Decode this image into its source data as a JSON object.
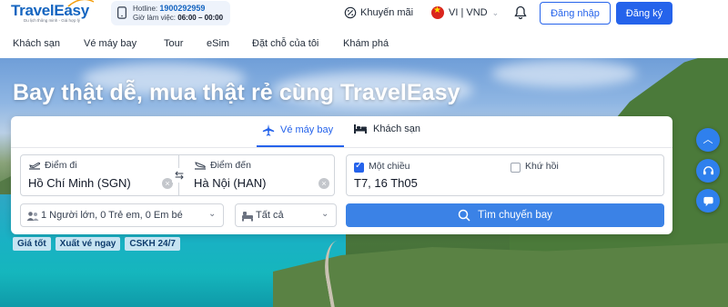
{
  "header": {
    "logo": "TravelEasy",
    "logo_tagline": "Du lịch thông minh - Giá hợp lý",
    "hotline_label": "Hotline:",
    "hotline_number": "1900292959",
    "hours_label": "Giờ làm việc:",
    "hours_value": "06:00 – 00:00",
    "promo": "Khuyến mãi",
    "lang_currency": "VI | VND",
    "login": "Đăng nhập",
    "register": "Đăng ký"
  },
  "nav": [
    "Khách sạn",
    "Vé máy bay",
    "Tour",
    "eSim",
    "Đặt chỗ của tôi",
    "Khám phá"
  ],
  "hero": {
    "title": "Bay thật dễ, mua thật rẻ cùng TravelEasy"
  },
  "search": {
    "tabs": [
      {
        "label": "Vé máy bay",
        "icon": "plane-icon",
        "active": true
      },
      {
        "label": "Khách sạn",
        "icon": "bed-icon",
        "active": false
      }
    ],
    "origin_label": "Điểm đi",
    "origin_value": "Hồ Chí Minh (SGN)",
    "destination_label": "Điểm đến",
    "destination_value": "Hà Nội (HAN)",
    "one_way_label": "Một chiều",
    "one_way_checked": true,
    "round_trip_label": "Khứ hồi",
    "round_trip_checked": false,
    "date_value": "T7, 16 Th05",
    "passengers": "1 Người lớn, 0 Trẻ em, 0 Em bé",
    "cabin_class": "Tất cả",
    "search_button": "Tìm chuyến bay"
  },
  "badges": [
    "Giá tốt",
    "Xuất vé ngay",
    "CSKH 24/7"
  ],
  "colors": {
    "primary": "#2563eb",
    "brand": "#1565c0",
    "search_button": "#3b82e6"
  }
}
